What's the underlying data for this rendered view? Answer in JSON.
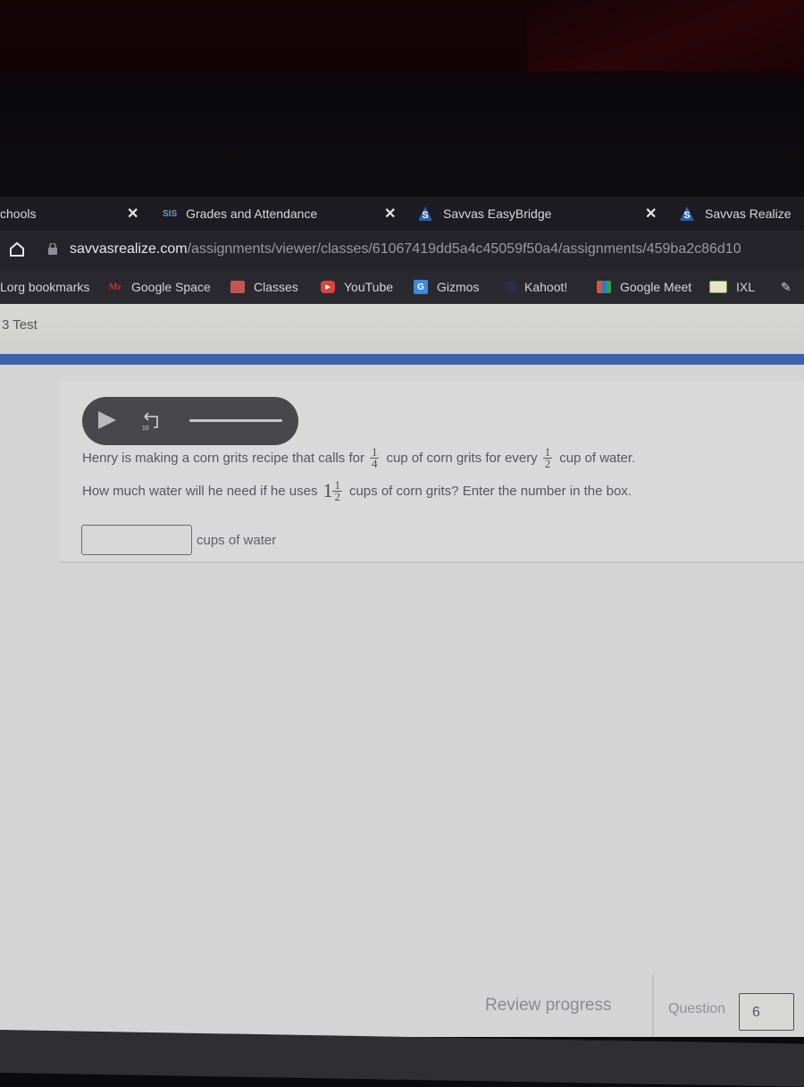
{
  "tabs": [
    {
      "label": "chools",
      "icon": "school-icon",
      "has_close": true
    },
    {
      "label": "Grades and Attendance",
      "icon": "sis-icon",
      "favicon_text": "SIS",
      "has_close": true
    },
    {
      "label": "Savvas EasyBridge",
      "icon": "savvas-icon",
      "favicon_text": "S",
      "has_close": true
    },
    {
      "label": "Savvas Realize",
      "icon": "savvas-icon",
      "favicon_text": "S",
      "has_close": false
    }
  ],
  "address_bar": {
    "domain": "savvasrealize.com",
    "path": "/assignments/viewer/classes/61067419dd5a4c45059f50a4/assignments/459ba2c86d10"
  },
  "bookmarks": [
    {
      "label": "Lorg bookmarks",
      "icon": null
    },
    {
      "label": "Google Space",
      "icon": "mr-icon",
      "favicon_text": "Mr"
    },
    {
      "label": "Classes",
      "icon": "classroom-icon"
    },
    {
      "label": "YouTube",
      "icon": "youtube-icon"
    },
    {
      "label": "Gizmos",
      "icon": "gizmos-icon",
      "favicon_text": "G"
    },
    {
      "label": "Kahoot!",
      "icon": "kahoot-icon"
    },
    {
      "label": "Google Meet",
      "icon": "meet-icon"
    },
    {
      "label": "IXL",
      "icon": "ixl-icon"
    }
  ],
  "page": {
    "title": "3 Test",
    "colors": {
      "accent_band": "#3e63ad"
    },
    "audio_player": {
      "replay_seconds": "10"
    },
    "question": {
      "line1_before": "Henry is making a corn grits recipe that calls for",
      "frac1": {
        "num": "1",
        "den": "4"
      },
      "line1_middle": "cup of corn grits for every",
      "frac2": {
        "num": "1",
        "den": "2"
      },
      "line1_after": "cup of water.",
      "line2_before": "How much water will he need if he uses",
      "mixed": {
        "whole": "1",
        "num": "1",
        "den": "2"
      },
      "line2_after": "cups of corn grits? Enter the number in the box."
    },
    "answer": {
      "value": "",
      "placeholder": "",
      "unit": "cups of water"
    },
    "footer": {
      "review_label": "Review progress",
      "question_label": "Question",
      "question_number": "6"
    }
  }
}
